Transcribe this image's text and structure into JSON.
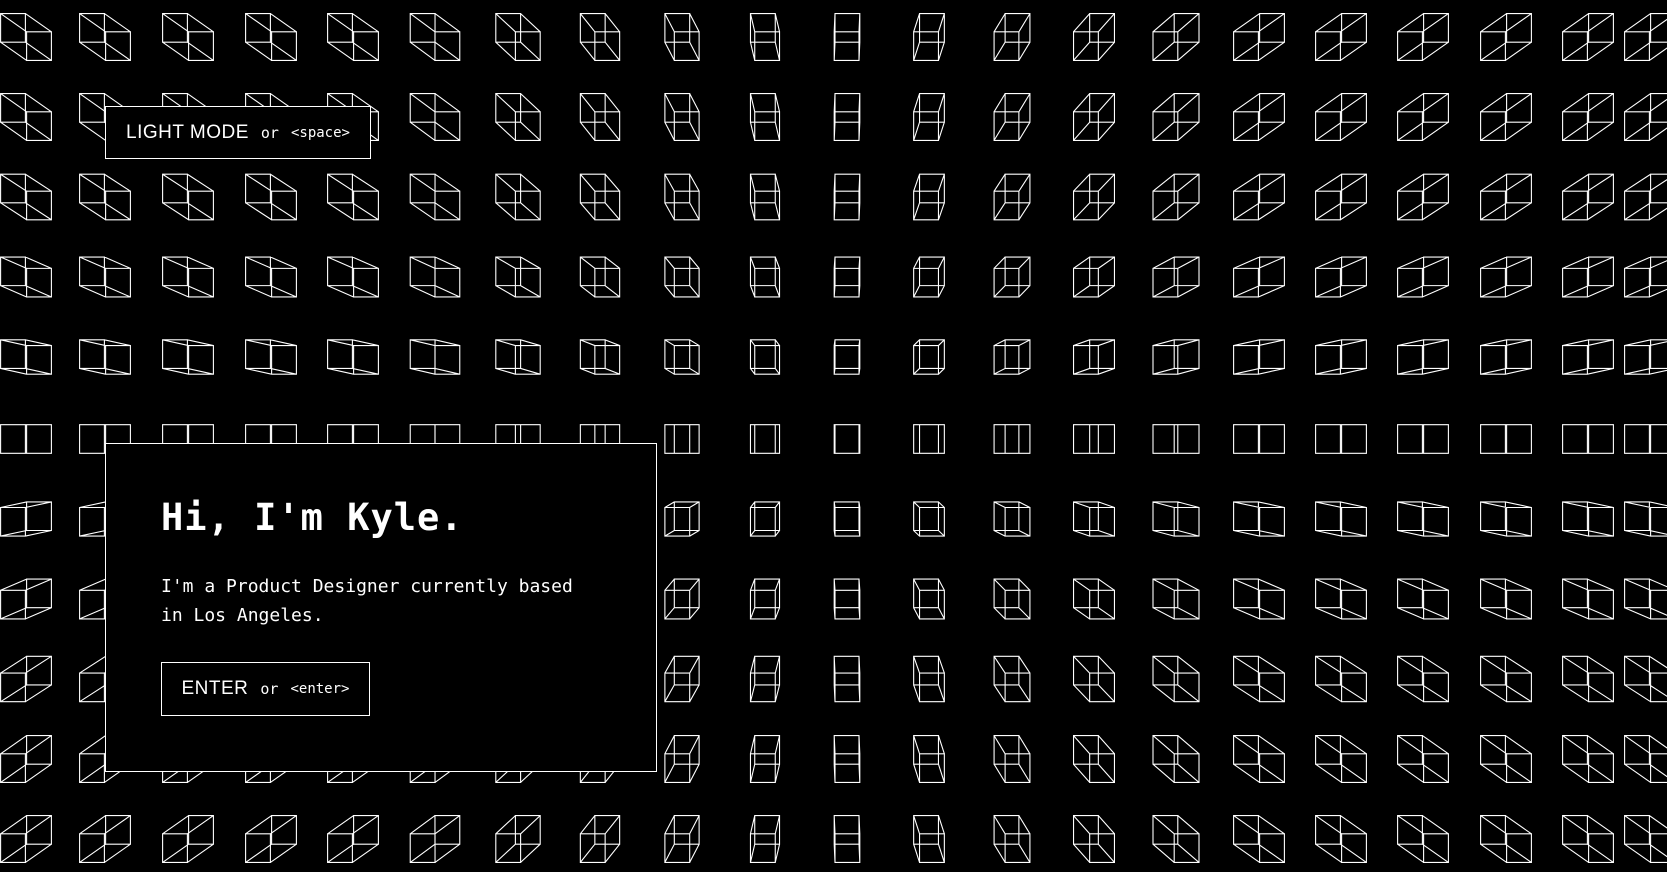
{
  "theme": {
    "background": "#000000",
    "foreground": "#ffffff"
  },
  "mode_toggle": {
    "label": "LIGHT MODE",
    "or": "or",
    "shortcut": "<space>"
  },
  "intro": {
    "title": "Hi, I'm Kyle.",
    "description": "I'm a Product Designer currently based in Los Angeles.",
    "enter_button": {
      "label": "ENTER",
      "or": "or",
      "shortcut": "<enter>"
    }
  },
  "background_pattern": {
    "icon": "wireframe-cube-icon",
    "columns": 21,
    "rows": 11
  }
}
